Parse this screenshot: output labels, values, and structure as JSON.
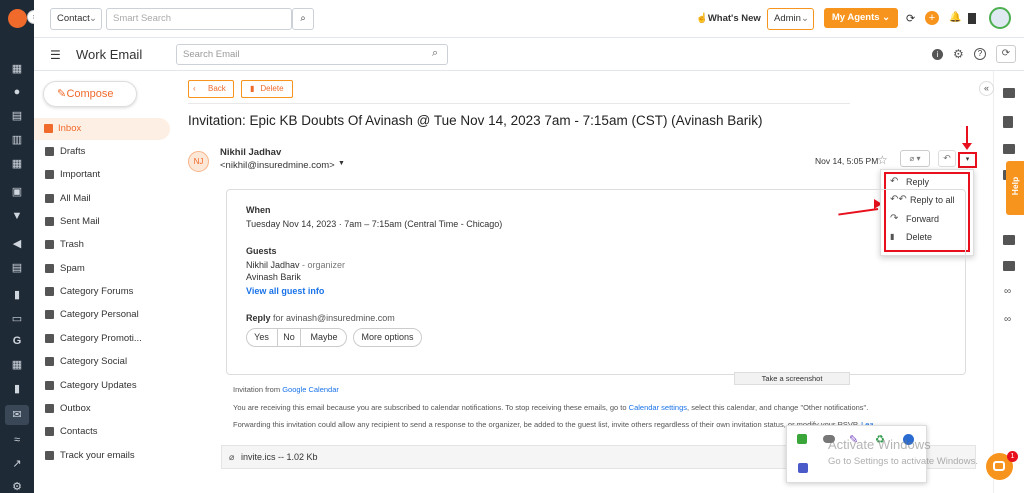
{
  "topbar": {
    "contact_select": "Contact",
    "search_placeholder": "Smart Search",
    "whats_new": "What's New",
    "admin_select": "Admin",
    "my_agents": "My Agents"
  },
  "header": {
    "title": "Work Email",
    "search_placeholder": "Search Email"
  },
  "sidebar": {
    "compose": "Compose",
    "items": [
      {
        "label": "Inbox"
      },
      {
        "label": "Drafts"
      },
      {
        "label": "Important"
      },
      {
        "label": "All Mail"
      },
      {
        "label": "Sent Mail"
      },
      {
        "label": "Trash"
      },
      {
        "label": "Spam"
      },
      {
        "label": "Category Forums"
      },
      {
        "label": "Category Personal"
      },
      {
        "label": "Category Promoti..."
      },
      {
        "label": "Category Social"
      },
      {
        "label": "Category Updates"
      },
      {
        "label": "Outbox"
      },
      {
        "label": "Contacts"
      },
      {
        "label": "Track your emails"
      }
    ]
  },
  "toolbar": {
    "back": "Back",
    "delete": "Delete"
  },
  "email": {
    "subject": "Invitation: Epic KB Doubts Of Avinash @ Tue Nov 14, 2023 7am - 7:15am (CST) (Avinash Barik)",
    "avatar_initials": "NJ",
    "sender_name": "Nikhil Jadhav",
    "sender_email": "<nikhil@insuredmine.com>",
    "date": "Nov 14, 5:05 PM"
  },
  "menu": {
    "reply": "Reply",
    "reply_all": "Reply to all",
    "forward": "Forward",
    "delete": "Delete"
  },
  "invite": {
    "when_label": "When",
    "when_value": "Tuesday Nov 14, 2023 · 7am – 7:15am (Central Time - Chicago)",
    "guests_label": "Guests",
    "guest1_name": "Nikhil Jadhav",
    "guest1_role": " - organizer",
    "guest2_name": "Avinash Barik",
    "view_all": "View all guest info",
    "reply_label": "Reply",
    "reply_for": " for avinash@insuredmine.com",
    "rsvp_yes": "Yes",
    "rsvp_no": "No",
    "rsvp_maybe": "Maybe",
    "more_options": "More options"
  },
  "footer": {
    "invitation_from": "Invitation from ",
    "google_calendar": "Google Calendar",
    "notice1_a": "You are receiving this email because you are subscribed to calendar notifications. To stop receiving these emails, go to ",
    "calendar_settings": "Calendar settings",
    "notice1_b": ", select this calendar, and change \"Other notifications\".",
    "notice2": "Forwarding this invitation could allow any recipient to send a response to the organizer, be added to the guest list, invite others regardless of their own invitation status, or modify your RSVP. ",
    "learn_more": "Learn more"
  },
  "attachment": {
    "name": "invite.ics -- 1.02 Kb"
  },
  "tooltip": "Take a screenshot",
  "watermark": {
    "title": "Activate Windows",
    "subtitle": "Go to Settings to activate Windows."
  },
  "help_tab": "Help",
  "chat_badge": "1",
  "colors": {
    "brand": "#f06a2b",
    "accent_orange": "#f7941d",
    "link": "#1a73e8",
    "annotation": "#e8101d"
  }
}
